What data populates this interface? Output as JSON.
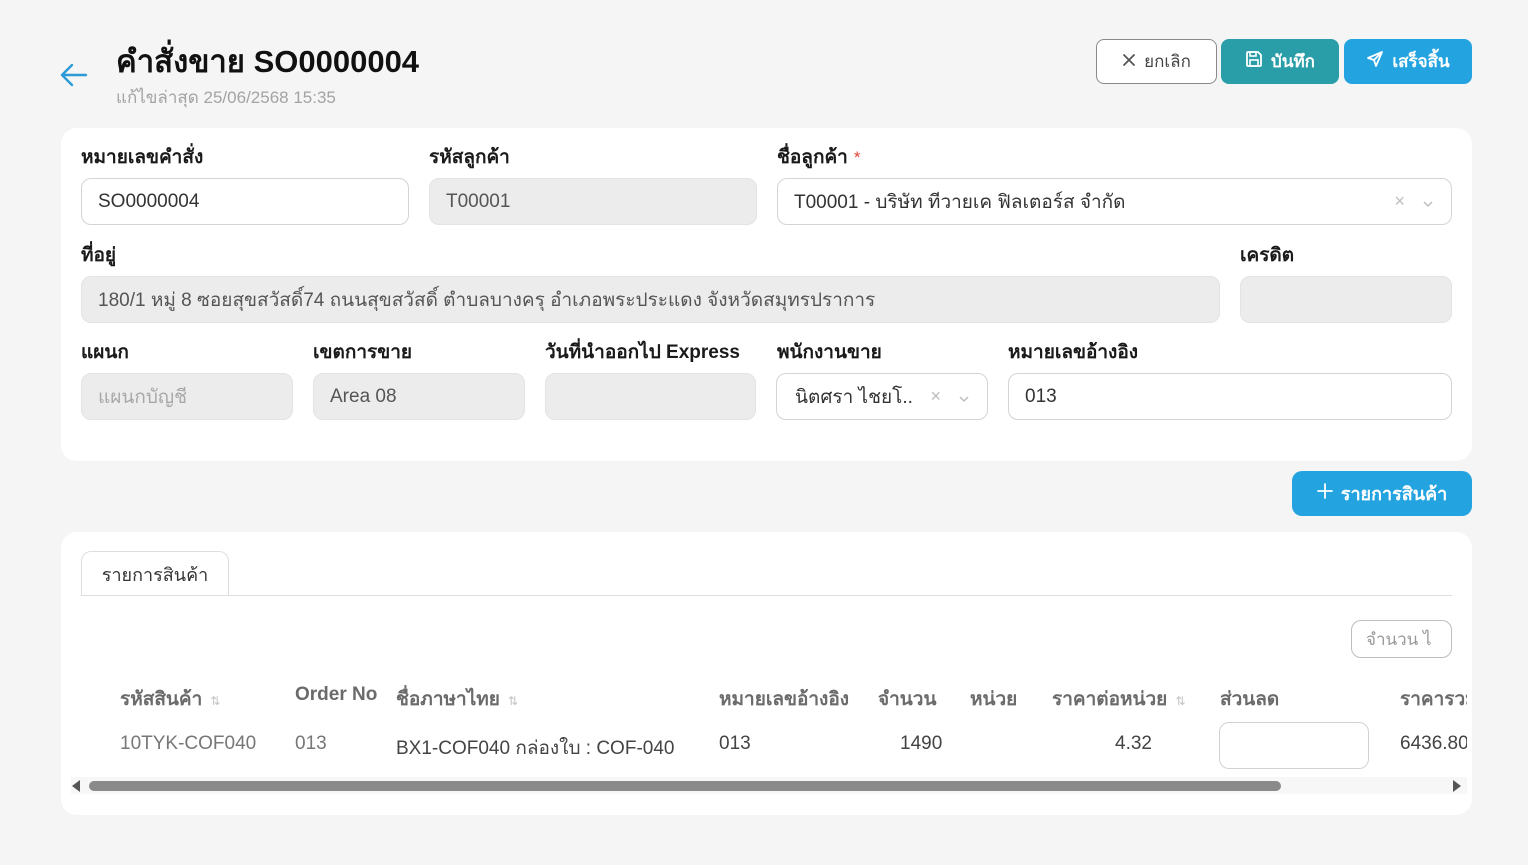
{
  "header": {
    "title": "คำสั่งขาย SO0000004",
    "subtitle": "แก้ไขล่าสุด 25/06/2568 15:35",
    "cancel_label": "ยกเลิก",
    "save_label": "บันทึก",
    "finish_label": "เสร็จสิ้น"
  },
  "form": {
    "order_no": {
      "label": "หมายเลขคำสั่ง",
      "value": "SO0000004"
    },
    "customer_code": {
      "label": "รหัสลูกค้า",
      "value": "T00001"
    },
    "customer_name": {
      "label": "ชื่อลูกค้า",
      "required_mark": "*",
      "value": "T00001 - บริษัท ทีวายเค ฟิลเตอร์ส จำกัด"
    },
    "address": {
      "label": "ที่อยู่",
      "value": "180/1 หมู่ 8 ซอยสุขสวัสดิ์74 ถนนสุขสวัสดิ์ ตำบลบางครุ อำเภอพระประแดง จังหวัดสมุทรปราการ"
    },
    "credit": {
      "label": "เครดิต",
      "value": ""
    },
    "department": {
      "label": "แผนก",
      "placeholder": "แผนกบัญชี"
    },
    "sales_area": {
      "label": "เขตการขาย",
      "value": "Area 08"
    },
    "express_date": {
      "label": "วันที่นำออกไป Express",
      "value": ""
    },
    "salesperson": {
      "label": "พนักงานขาย",
      "value": "นิตศรา ไชยโ.."
    },
    "reference_no": {
      "label": "หมายเลขอ้างอิง",
      "value": "013"
    }
  },
  "add_item_label": "รายการสินค้า",
  "tabs": [
    {
      "label": "รายการสินค้า",
      "active": true
    }
  ],
  "columns_button_label": "จำนวน ไ",
  "table": {
    "headers": [
      "รหัสสินค้า",
      "Order No",
      "ชื่อภาษาไทย",
      "หมายเลขอ้างอิง",
      "จำนวน",
      "หน่วย",
      "ราคาต่อหน่วย",
      "ส่วนลด",
      "ราคารวม"
    ],
    "sort_glyph": "⇅",
    "rows": [
      {
        "code": "10TYK-COF040",
        "order_no": "013",
        "name_th": "BX1-COF040 กล่องใบ : COF-040",
        "ref_no": "013",
        "qty": "1490",
        "unit": "",
        "unit_price": "4.32",
        "discount": "",
        "total": "6436.80"
      }
    ]
  },
  "colors": {
    "primary": "#23a3e0",
    "save": "#2a9ea8",
    "required": "#e0453a"
  }
}
